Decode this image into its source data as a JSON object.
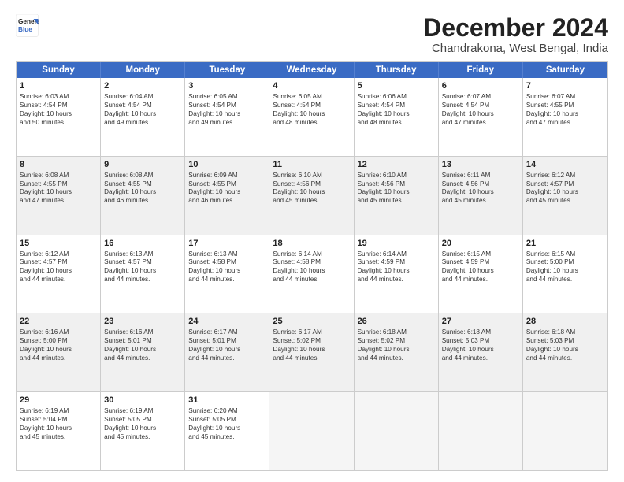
{
  "logo": {
    "line1": "General",
    "line2": "Blue"
  },
  "title": "December 2024",
  "subtitle": "Chandrakona, West Bengal, India",
  "header": {
    "days": [
      "Sunday",
      "Monday",
      "Tuesday",
      "Wednesday",
      "Thursday",
      "Friday",
      "Saturday"
    ]
  },
  "rows": [
    [
      {
        "day": "1",
        "lines": [
          "Sunrise: 6:03 AM",
          "Sunset: 4:54 PM",
          "Daylight: 10 hours",
          "and 50 minutes."
        ]
      },
      {
        "day": "2",
        "lines": [
          "Sunrise: 6:04 AM",
          "Sunset: 4:54 PM",
          "Daylight: 10 hours",
          "and 49 minutes."
        ]
      },
      {
        "day": "3",
        "lines": [
          "Sunrise: 6:05 AM",
          "Sunset: 4:54 PM",
          "Daylight: 10 hours",
          "and 49 minutes."
        ]
      },
      {
        "day": "4",
        "lines": [
          "Sunrise: 6:05 AM",
          "Sunset: 4:54 PM",
          "Daylight: 10 hours",
          "and 48 minutes."
        ]
      },
      {
        "day": "5",
        "lines": [
          "Sunrise: 6:06 AM",
          "Sunset: 4:54 PM",
          "Daylight: 10 hours",
          "and 48 minutes."
        ]
      },
      {
        "day": "6",
        "lines": [
          "Sunrise: 6:07 AM",
          "Sunset: 4:54 PM",
          "Daylight: 10 hours",
          "and 47 minutes."
        ]
      },
      {
        "day": "7",
        "lines": [
          "Sunrise: 6:07 AM",
          "Sunset: 4:55 PM",
          "Daylight: 10 hours",
          "and 47 minutes."
        ]
      }
    ],
    [
      {
        "day": "8",
        "lines": [
          "Sunrise: 6:08 AM",
          "Sunset: 4:55 PM",
          "Daylight: 10 hours",
          "and 47 minutes."
        ]
      },
      {
        "day": "9",
        "lines": [
          "Sunrise: 6:08 AM",
          "Sunset: 4:55 PM",
          "Daylight: 10 hours",
          "and 46 minutes."
        ]
      },
      {
        "day": "10",
        "lines": [
          "Sunrise: 6:09 AM",
          "Sunset: 4:55 PM",
          "Daylight: 10 hours",
          "and 46 minutes."
        ]
      },
      {
        "day": "11",
        "lines": [
          "Sunrise: 6:10 AM",
          "Sunset: 4:56 PM",
          "Daylight: 10 hours",
          "and 45 minutes."
        ]
      },
      {
        "day": "12",
        "lines": [
          "Sunrise: 6:10 AM",
          "Sunset: 4:56 PM",
          "Daylight: 10 hours",
          "and 45 minutes."
        ]
      },
      {
        "day": "13",
        "lines": [
          "Sunrise: 6:11 AM",
          "Sunset: 4:56 PM",
          "Daylight: 10 hours",
          "and 45 minutes."
        ]
      },
      {
        "day": "14",
        "lines": [
          "Sunrise: 6:12 AM",
          "Sunset: 4:57 PM",
          "Daylight: 10 hours",
          "and 45 minutes."
        ]
      }
    ],
    [
      {
        "day": "15",
        "lines": [
          "Sunrise: 6:12 AM",
          "Sunset: 4:57 PM",
          "Daylight: 10 hours",
          "and 44 minutes."
        ]
      },
      {
        "day": "16",
        "lines": [
          "Sunrise: 6:13 AM",
          "Sunset: 4:57 PM",
          "Daylight: 10 hours",
          "and 44 minutes."
        ]
      },
      {
        "day": "17",
        "lines": [
          "Sunrise: 6:13 AM",
          "Sunset: 4:58 PM",
          "Daylight: 10 hours",
          "and 44 minutes."
        ]
      },
      {
        "day": "18",
        "lines": [
          "Sunrise: 6:14 AM",
          "Sunset: 4:58 PM",
          "Daylight: 10 hours",
          "and 44 minutes."
        ]
      },
      {
        "day": "19",
        "lines": [
          "Sunrise: 6:14 AM",
          "Sunset: 4:59 PM",
          "Daylight: 10 hours",
          "and 44 minutes."
        ]
      },
      {
        "day": "20",
        "lines": [
          "Sunrise: 6:15 AM",
          "Sunset: 4:59 PM",
          "Daylight: 10 hours",
          "and 44 minutes."
        ]
      },
      {
        "day": "21",
        "lines": [
          "Sunrise: 6:15 AM",
          "Sunset: 5:00 PM",
          "Daylight: 10 hours",
          "and 44 minutes."
        ]
      }
    ],
    [
      {
        "day": "22",
        "lines": [
          "Sunrise: 6:16 AM",
          "Sunset: 5:00 PM",
          "Daylight: 10 hours",
          "and 44 minutes."
        ]
      },
      {
        "day": "23",
        "lines": [
          "Sunrise: 6:16 AM",
          "Sunset: 5:01 PM",
          "Daylight: 10 hours",
          "and 44 minutes."
        ]
      },
      {
        "day": "24",
        "lines": [
          "Sunrise: 6:17 AM",
          "Sunset: 5:01 PM",
          "Daylight: 10 hours",
          "and 44 minutes."
        ]
      },
      {
        "day": "25",
        "lines": [
          "Sunrise: 6:17 AM",
          "Sunset: 5:02 PM",
          "Daylight: 10 hours",
          "and 44 minutes."
        ]
      },
      {
        "day": "26",
        "lines": [
          "Sunrise: 6:18 AM",
          "Sunset: 5:02 PM",
          "Daylight: 10 hours",
          "and 44 minutes."
        ]
      },
      {
        "day": "27",
        "lines": [
          "Sunrise: 6:18 AM",
          "Sunset: 5:03 PM",
          "Daylight: 10 hours",
          "and 44 minutes."
        ]
      },
      {
        "day": "28",
        "lines": [
          "Sunrise: 6:18 AM",
          "Sunset: 5:03 PM",
          "Daylight: 10 hours",
          "and 44 minutes."
        ]
      }
    ],
    [
      {
        "day": "29",
        "lines": [
          "Sunrise: 6:19 AM",
          "Sunset: 5:04 PM",
          "Daylight: 10 hours",
          "and 45 minutes."
        ]
      },
      {
        "day": "30",
        "lines": [
          "Sunrise: 6:19 AM",
          "Sunset: 5:05 PM",
          "Daylight: 10 hours",
          "and 45 minutes."
        ]
      },
      {
        "day": "31",
        "lines": [
          "Sunrise: 6:20 AM",
          "Sunset: 5:05 PM",
          "Daylight: 10 hours",
          "and 45 minutes."
        ]
      },
      {
        "day": "",
        "lines": []
      },
      {
        "day": "",
        "lines": []
      },
      {
        "day": "",
        "lines": []
      },
      {
        "day": "",
        "lines": []
      }
    ]
  ]
}
